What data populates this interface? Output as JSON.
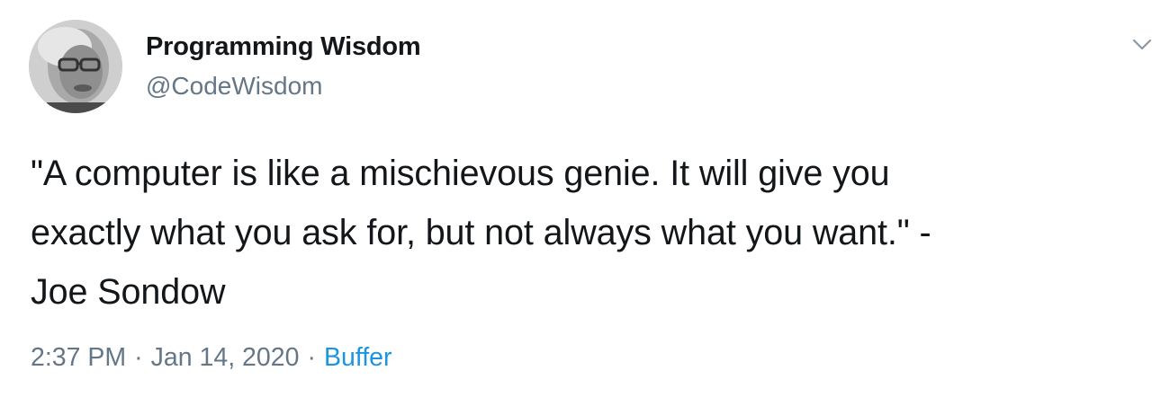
{
  "tweet": {
    "author": {
      "display_name": "Programming Wisdom",
      "handle": "@CodeWisdom"
    },
    "text_lines": [
      "\"A computer is like a mischievous genie. It will give you",
      "exactly what you ask for, but not always what you want.\" -",
      "Joe Sondow"
    ],
    "time": "2:37 PM",
    "separator": "·",
    "date": "Jan 14, 2020",
    "source": "Buffer"
  },
  "icons": {
    "menu": "chevron-down-icon"
  },
  "colors": {
    "text": "#14171a",
    "secondary": "#657786",
    "link": "#1b95e0",
    "background": "#ffffff"
  }
}
